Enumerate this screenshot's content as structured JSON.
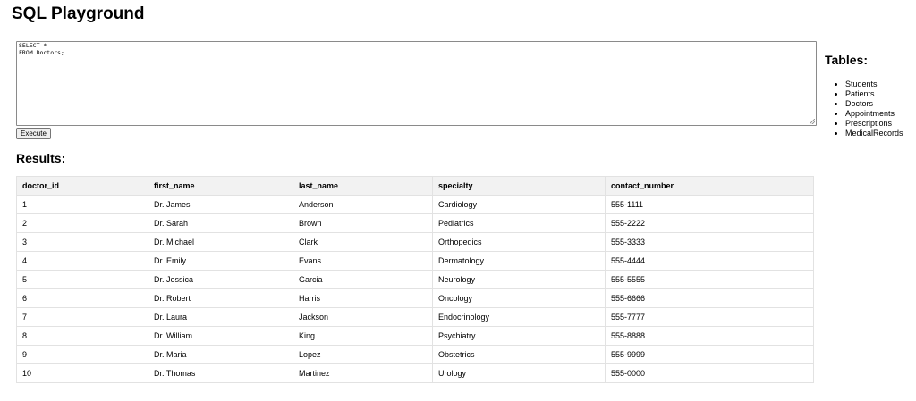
{
  "page": {
    "title": "SQL Playground"
  },
  "editor": {
    "query": "SELECT *\nFROM Doctors;"
  },
  "execute_button": {
    "label": "Execute"
  },
  "results": {
    "heading": "Results:",
    "columns": [
      "doctor_id",
      "first_name",
      "last_name",
      "specialty",
      "contact_number"
    ],
    "rows": [
      [
        "1",
        "Dr. James",
        "Anderson",
        "Cardiology",
        "555-1111"
      ],
      [
        "2",
        "Dr. Sarah",
        "Brown",
        "Pediatrics",
        "555-2222"
      ],
      [
        "3",
        "Dr. Michael",
        "Clark",
        "Orthopedics",
        "555-3333"
      ],
      [
        "4",
        "Dr. Emily",
        "Evans",
        "Dermatology",
        "555-4444"
      ],
      [
        "5",
        "Dr. Jessica",
        "Garcia",
        "Neurology",
        "555-5555"
      ],
      [
        "6",
        "Dr. Robert",
        "Harris",
        "Oncology",
        "555-6666"
      ],
      [
        "7",
        "Dr. Laura",
        "Jackson",
        "Endocrinology",
        "555-7777"
      ],
      [
        "8",
        "Dr. William",
        "King",
        "Psychiatry",
        "555-8888"
      ],
      [
        "9",
        "Dr. Maria",
        "Lopez",
        "Obstetrics",
        "555-9999"
      ],
      [
        "10",
        "Dr. Thomas",
        "Martinez",
        "Urology",
        "555-0000"
      ]
    ]
  },
  "tables_panel": {
    "heading": "Tables:",
    "items": [
      "Students",
      "Patients",
      "Doctors",
      "Appointments",
      "Prescriptions",
      "MedicalRecords"
    ]
  }
}
